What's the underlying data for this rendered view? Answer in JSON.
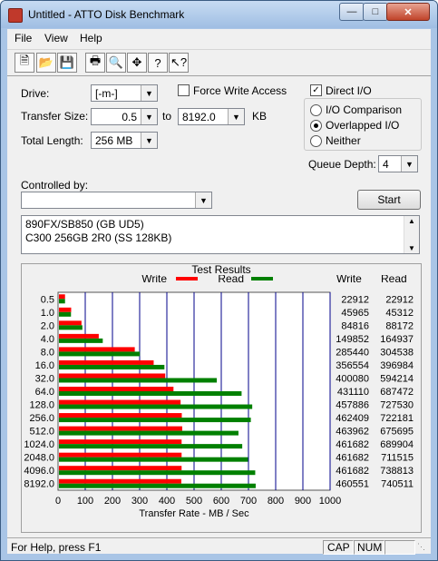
{
  "window": {
    "title": "Untitled - ATTO Disk Benchmark",
    "close": "✕"
  },
  "menu": [
    "File",
    "View",
    "Help"
  ],
  "toolbar_icons": [
    "new-file-icon",
    "open-folder-icon",
    "save-icon",
    "print-icon",
    "print-preview-icon",
    "move-icon",
    "help-icon",
    "context-help-icon"
  ],
  "drive": {
    "label": "Drive:",
    "value": "[-m-]"
  },
  "force_write": {
    "label": "Force Write Access",
    "checked": false
  },
  "direct_io": {
    "label": "Direct I/O",
    "checked": true
  },
  "transfer_size": {
    "label": "Transfer Size:",
    "from": "0.5",
    "to_label": "to",
    "to": "8192.0",
    "unit": "KB"
  },
  "total_length": {
    "label": "Total Length:",
    "value": "256 MB"
  },
  "io_modes": [
    {
      "label": "I/O Comparison",
      "selected": false
    },
    {
      "label": "Overlapped I/O",
      "selected": true
    },
    {
      "label": "Neither",
      "selected": false
    }
  ],
  "queue_depth": {
    "label": "Queue Depth:",
    "value": "4"
  },
  "controlled_by": {
    "label": "Controlled by:",
    "value": ""
  },
  "start_button": "Start",
  "description": [
    "890FX/SB850 (GB UD5)",
    "C300 256GB 2R0 (SS 128KB)"
  ],
  "results": {
    "title": "Test Results",
    "write_legend": "Write",
    "read_legend": "Read",
    "write_col": "Write",
    "read_col": "Read",
    "colors": {
      "write": "#ff0000",
      "read": "#008000",
      "grid": "#00008b"
    }
  },
  "chart_data": {
    "type": "bar",
    "orientation": "horizontal",
    "title": "Test Results",
    "xlabel": "Transfer Rate - MB / Sec",
    "xlim": [
      0,
      1000
    ],
    "xticks": [
      "0",
      "100",
      "200",
      "300",
      "400",
      "500",
      "600",
      "700",
      "800",
      "900",
      "1000"
    ],
    "categories": [
      "0.5",
      "1.0",
      "2.0",
      "4.0",
      "8.0",
      "16.0",
      "32.0",
      "64.0",
      "128.0",
      "256.0",
      "512.0",
      "1024.0",
      "2048.0",
      "4096.0",
      "8192.0"
    ],
    "series": [
      {
        "name": "Write",
        "values": [
          22912,
          45965,
          84816,
          149852,
          285440,
          356554,
          400080,
          431110,
          457886,
          462409,
          463962,
          461682,
          461682,
          461682,
          460551
        ]
      },
      {
        "name": "Read",
        "values": [
          22912,
          45312,
          88172,
          164937,
          304538,
          396984,
          594214,
          687472,
          727530,
          722181,
          675695,
          689904,
          711515,
          738813,
          740511
        ]
      }
    ]
  },
  "status": {
    "help": "For Help, press F1",
    "cap": "CAP",
    "num": "NUM"
  }
}
